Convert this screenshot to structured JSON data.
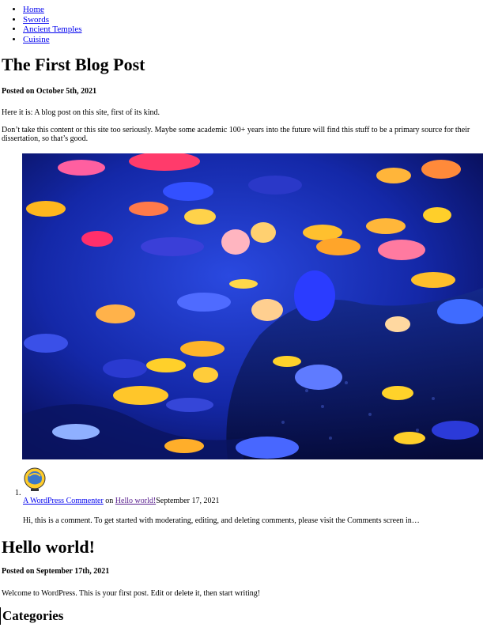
{
  "nav": {
    "items": [
      {
        "label": "Home"
      },
      {
        "label": "Swords"
      },
      {
        "label": "Ancient Temples"
      },
      {
        "label": "Cuisine"
      }
    ]
  },
  "post1": {
    "title": "The First Blog Post",
    "posted": "Posted on October 5th, 2021",
    "paragraphs": [
      "Here it is: A blog post on this site, first of its kind.",
      "Don’t take this content or this site too seriously. Maybe some academic 100+ years into the future will find this stuff to be a primary source for their dissertation, so that’s good."
    ]
  },
  "comments": {
    "items": [
      {
        "number": "1.",
        "author": "A WordPress Commenter",
        "on": "on",
        "post_link": "Hello world!",
        "date": "September 17, 2021",
        "excerpt": "Hi, this is a comment. To get started with moderating, editing, and deleting comments, please visit the Comments screen in…"
      }
    ]
  },
  "post2": {
    "title": "Hello world!",
    "posted": "Posted on September 17th, 2021",
    "paragraph": "Welcome to WordPress. This is your first post. Edit or delete it, then start writing!"
  },
  "sidebar": {
    "categories_heading": "Categories"
  },
  "colors": {
    "link": "#0000ee",
    "visited_link": "#551a8b",
    "aquarium_dark": "#0a0f5e",
    "aquarium_mid": "#1e3bd1"
  }
}
